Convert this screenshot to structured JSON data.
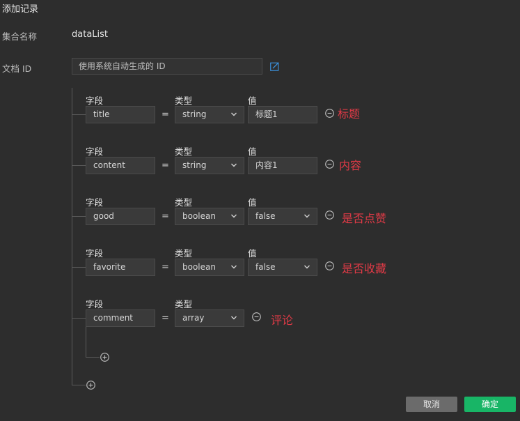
{
  "dialog": {
    "title": "添加记录"
  },
  "collection": {
    "label": "集合名称",
    "value": "dataList"
  },
  "doc_id": {
    "label": "文档 ID",
    "placeholder": "使用系统自动生成的 ID"
  },
  "columns": {
    "field": "字段",
    "type": "类型",
    "value": "值"
  },
  "equals": "=",
  "rows": [
    {
      "field": "title",
      "type": "string",
      "value": "标题1",
      "value_kind": "input",
      "note": "标题"
    },
    {
      "field": "content",
      "type": "string",
      "value": "内容1",
      "value_kind": "input",
      "note": "内容"
    },
    {
      "field": "good",
      "type": "boolean",
      "value": "false",
      "value_kind": "select",
      "note": "是否点赞"
    },
    {
      "field": "favorite",
      "type": "boolean",
      "value": "false",
      "value_kind": "select",
      "note": "是否收藏"
    },
    {
      "field": "comment",
      "type": "array",
      "value": null,
      "value_kind": "none",
      "note": "评论"
    }
  ],
  "footer": {
    "cancel_label": "取消",
    "confirm_label": "确定"
  },
  "colors": {
    "accent": "#18b566",
    "note": "#e03a46",
    "link": "#3b8fd9"
  }
}
